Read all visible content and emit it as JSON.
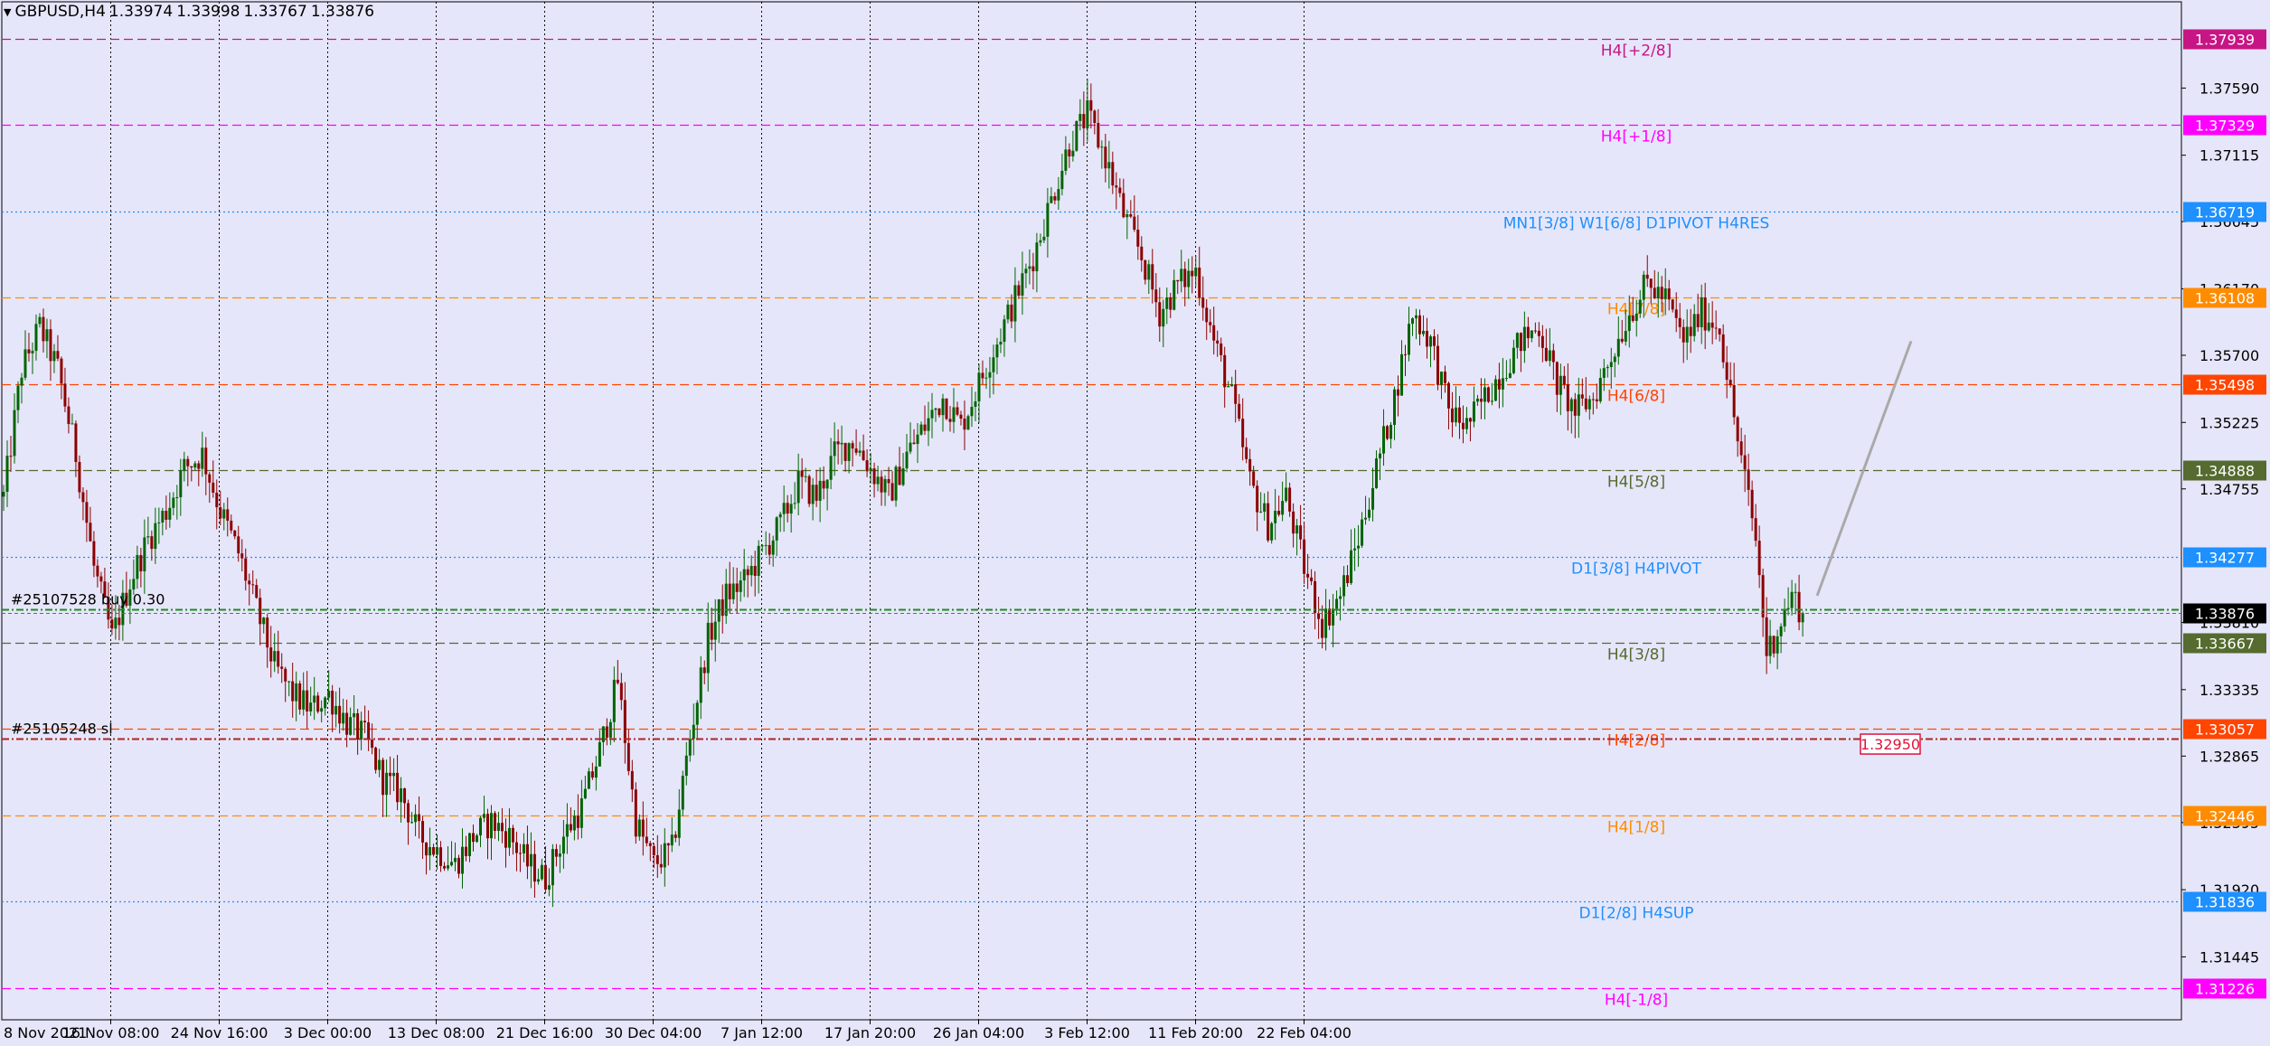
{
  "header": {
    "symbol": "GBPUSD,H4",
    "open": "1.33974",
    "high": "1.33998",
    "low": "1.33767",
    "close": "1.33876"
  },
  "colors": {
    "background": "#E6E6FA",
    "bull_candle": "#006400",
    "bear_candle": "#8B0000",
    "axis": "#000000"
  },
  "chart_data": {
    "type": "candlestick",
    "symbol": "GBPUSD",
    "timeframe": "H4",
    "grid": true,
    "price_axis": {
      "ylim": [
        1.31,
        1.382
      ],
      "tick_labels": [
        "1.37590",
        "1.37115",
        "1.36645",
        "1.36170",
        "1.35700",
        "1.35225",
        "1.34755",
        "1.33810",
        "1.33335",
        "1.32865",
        "1.32395",
        "1.31920",
        "1.31445"
      ]
    },
    "time_axis": {
      "labels": [
        "8 Nov 2021",
        "16 Nov 08:00",
        "24 Nov 16:00",
        "3 Dec 00:00",
        "13 Dec 08:00",
        "21 Dec 16:00",
        "30 Dec 04:00",
        "7 Jan 12:00",
        "17 Jan 20:00",
        "26 Jan 04:00",
        "3 Feb 12:00",
        "11 Feb 20:00",
        "22 Feb 04:00"
      ]
    },
    "close_path": [
      [
        0,
        1.347
      ],
      [
        5,
        1.356
      ],
      [
        10,
        1.359
      ],
      [
        15,
        1.356
      ],
      [
        20,
        1.35
      ],
      [
        25,
        1.342
      ],
      [
        30,
        1.337
      ],
      [
        35,
        1.341
      ],
      [
        40,
        1.344
      ],
      [
        45,
        1.346
      ],
      [
        50,
        1.349
      ],
      [
        55,
        1.35
      ],
      [
        60,
        1.346
      ],
      [
        65,
        1.343
      ],
      [
        70,
        1.339
      ],
      [
        75,
        1.335
      ],
      [
        80,
        1.333
      ],
      [
        85,
        1.332
      ],
      [
        90,
        1.333
      ],
      [
        95,
        1.331
      ],
      [
        100,
        1.33
      ],
      [
        105,
        1.327
      ],
      [
        110,
        1.326
      ],
      [
        115,
        1.323
      ],
      [
        120,
        1.322
      ],
      [
        125,
        1.321
      ],
      [
        130,
        1.323
      ],
      [
        135,
        1.324
      ],
      [
        140,
        1.323
      ],
      [
        145,
        1.321
      ],
      [
        150,
        1.32
      ],
      [
        155,
        1.323
      ],
      [
        160,
        1.325
      ],
      [
        165,
        1.329
      ],
      [
        170,
        1.334
      ],
      [
        175,
        1.324
      ],
      [
        180,
        1.321
      ],
      [
        185,
        1.322
      ],
      [
        190,
        1.33
      ],
      [
        195,
        1.337
      ],
      [
        200,
        1.34
      ],
      [
        205,
        1.341
      ],
      [
        210,
        1.343
      ],
      [
        215,
        1.345
      ],
      [
        220,
        1.348
      ],
      [
        225,
        1.347
      ],
      [
        230,
        1.35
      ],
      [
        235,
        1.351
      ],
      [
        240,
        1.349
      ],
      [
        245,
        1.347
      ],
      [
        250,
        1.35
      ],
      [
        255,
        1.352
      ],
      [
        260,
        1.354
      ],
      [
        265,
        1.352
      ],
      [
        270,
        1.355
      ],
      [
        275,
        1.358
      ],
      [
        280,
        1.361
      ],
      [
        285,
        1.364
      ],
      [
        290,
        1.368
      ],
      [
        295,
        1.372
      ],
      [
        300,
        1.374
      ],
      [
        305,
        1.371
      ],
      [
        310,
        1.367
      ],
      [
        315,
        1.364
      ],
      [
        320,
        1.36
      ],
      [
        325,
        1.362
      ],
      [
        330,
        1.363
      ],
      [
        335,
        1.358
      ],
      [
        340,
        1.354
      ],
      [
        345,
        1.348
      ],
      [
        350,
        1.345
      ],
      [
        355,
        1.347
      ],
      [
        360,
        1.342
      ],
      [
        365,
        1.338
      ],
      [
        370,
        1.34
      ],
      [
        375,
        1.344
      ],
      [
        380,
        1.349
      ],
      [
        385,
        1.354
      ],
      [
        390,
        1.36
      ],
      [
        395,
        1.358
      ],
      [
        400,
        1.353
      ],
      [
        405,
        1.352
      ],
      [
        410,
        1.354
      ],
      [
        415,
        1.356
      ],
      [
        420,
        1.358
      ],
      [
        425,
        1.359
      ],
      [
        430,
        1.355
      ],
      [
        435,
        1.353
      ],
      [
        440,
        1.354
      ],
      [
        445,
        1.357
      ],
      [
        450,
        1.36
      ],
      [
        455,
        1.362
      ],
      [
        460,
        1.361
      ],
      [
        465,
        1.358
      ],
      [
        470,
        1.36
      ],
      [
        475,
        1.359
      ],
      [
        480,
        1.351
      ],
      [
        485,
        1.344
      ],
      [
        488,
        1.336
      ],
      [
        490,
        1.337
      ],
      [
        495,
        1.34
      ],
      [
        498,
        1.3388
      ]
    ],
    "levels": [
      {
        "label": "H4[+2/8]",
        "price": "1.37939",
        "color": "#C71585",
        "style": "dash"
      },
      {
        "label": "H4[+1/8]",
        "price": "1.37329",
        "color": "#FF00FF",
        "style": "dash"
      },
      {
        "label": "MN1[3/8] W1[6/8] D1PIVOT H4RES",
        "price": "1.36719",
        "color": "#1E90FF",
        "style": "dot"
      },
      {
        "label": "H4[7/8]",
        "price": "1.36108",
        "color": "#FF8C00",
        "style": "dash"
      },
      {
        "label": "H4[6/8]",
        "price": "1.35498",
        "color": "#FF4500",
        "style": "dash"
      },
      {
        "label": "H4[5/8]",
        "price": "1.34888",
        "color": "#556B2F",
        "style": "dash"
      },
      {
        "label": "D1[3/8] H4PIVOT",
        "price": "1.34277",
        "color": "#1E90FF",
        "style": "dot"
      },
      {
        "label": "H4[3/8]",
        "price": "1.33667",
        "color": "#556B2F",
        "style": "dash"
      },
      {
        "label": "H4[2/8]",
        "price": "1.33057",
        "color": "#FF4500",
        "style": "dash"
      },
      {
        "label": "H4[1/8]",
        "price": "1.32446",
        "color": "#FF8C00",
        "style": "dash"
      },
      {
        "label": "D1[2/8] H4SUP",
        "price": "1.31836",
        "color": "#1E90FF",
        "style": "dot"
      },
      {
        "label": "H4[-1/8]",
        "price": "1.31226",
        "color": "#FF00FF",
        "style": "dash"
      }
    ],
    "current_price": "1.33876",
    "alert_price": "1.32950",
    "orders": [
      {
        "label": "#25107528 buy 0.30",
        "price": 1.339,
        "color": "#228B22"
      },
      {
        "label": "#25105248 sl",
        "price": 1.3299,
        "color": "#B22222"
      }
    ],
    "trendline": {
      "x1": 502,
      "y1": 1.34,
      "x2": 528,
      "y2": 1.358
    }
  }
}
